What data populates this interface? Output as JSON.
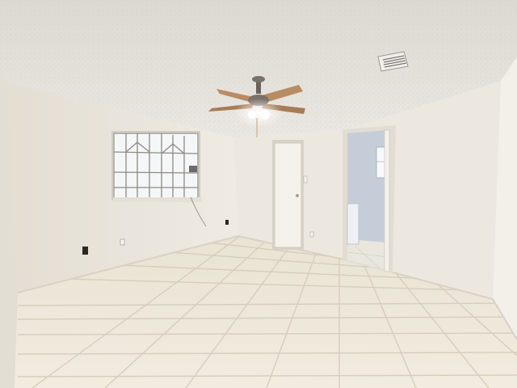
{
  "scene": {
    "colors": {
      "ceiling": "#e7e4df",
      "wall_left": "#ebe6dc",
      "wall_back": "#ece8e0",
      "wall_right": "#eeeae3",
      "floor": "#ece6d6",
      "grout": "#d6cfbf",
      "window_glass": "#f7f8fa",
      "bath_wall": "#c9d2dc",
      "fan_blade": "#b88c62",
      "fan_metal": "#6a625a"
    },
    "elements": [
      "ceiling",
      "left-wall",
      "back-wall",
      "right-wall",
      "tile-floor",
      "barred-window",
      "closet-door",
      "bathroom-doorway",
      "bathroom-vanity",
      "bathroom-window",
      "ceiling-fan",
      "fan-light",
      "air-vent",
      "electrical-outlet",
      "light-switch",
      "fan-pull-chain"
    ]
  }
}
